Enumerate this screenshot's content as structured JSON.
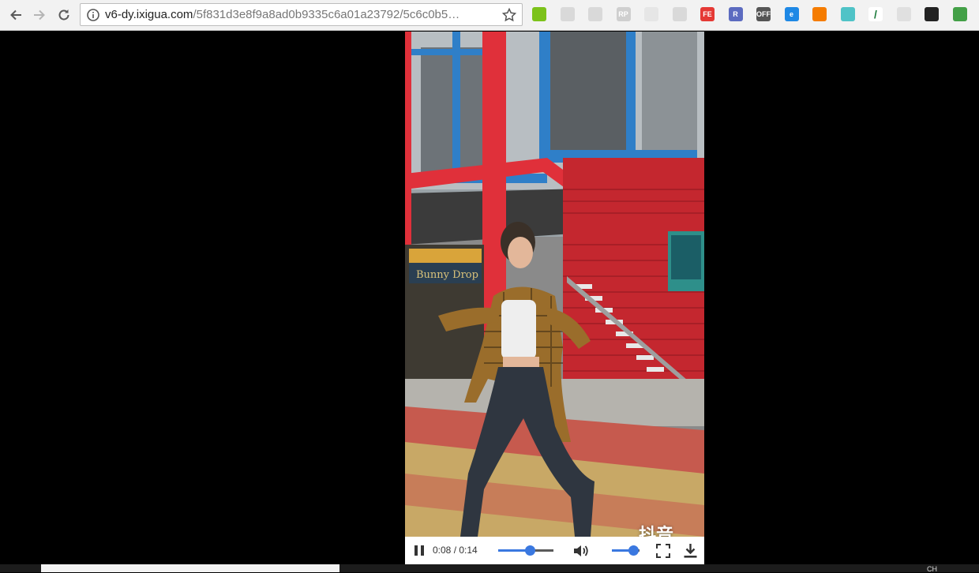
{
  "browser": {
    "url_host": "v6-dy.ixigua.com",
    "url_path": "/5f831d3e8f9a8ad0b9335c6a01a23792/5c6c0b5…",
    "extensions": [
      {
        "name": "vpn-extension-icon",
        "label": "",
        "color": "#7cc21a"
      },
      {
        "name": "image-extension-icon",
        "label": "",
        "color": "#d9d9d9"
      },
      {
        "name": "tree-extension-icon",
        "label": "",
        "color": "#d9d9d9"
      },
      {
        "name": "rp-extension-icon",
        "label": "RP",
        "color": "#cfcfcf"
      },
      {
        "name": "blank-extension-icon",
        "label": "",
        "color": "#e6e6e6"
      },
      {
        "name": "grid-extension-icon",
        "label": "",
        "color": "#d9d9d9"
      },
      {
        "name": "fe-extension-icon",
        "label": "FE",
        "color": "#e53935"
      },
      {
        "name": "react-extension-icon",
        "label": "R",
        "color": "#5c6bc0"
      },
      {
        "name": "off-extension-icon",
        "label": "OFF",
        "color": "#555555"
      },
      {
        "name": "ie-extension-icon",
        "label": "e",
        "color": "#1e88e5"
      },
      {
        "name": "lifebuoy-extension-icon",
        "label": "",
        "color": "#f57c00"
      },
      {
        "name": "atom-extension-icon",
        "label": "",
        "color": "#4fc3c7"
      },
      {
        "name": "pen-extension-icon",
        "label": "/",
        "color": "#ffffff"
      },
      {
        "name": "shield-extension-icon",
        "label": "",
        "color": "#e0e0e0"
      },
      {
        "name": "glasses-extension-icon",
        "label": "",
        "color": "#222222"
      },
      {
        "name": "download-extension-icon",
        "label": "",
        "color": "#43a047"
      }
    ]
  },
  "player": {
    "time_display": "0:08 / 0:14",
    "progress_fraction": 0.57,
    "volume_fraction": 0.78,
    "watermark": "抖音",
    "accent_color": "#3a78e0"
  },
  "taskbar": {
    "language": "CH"
  }
}
